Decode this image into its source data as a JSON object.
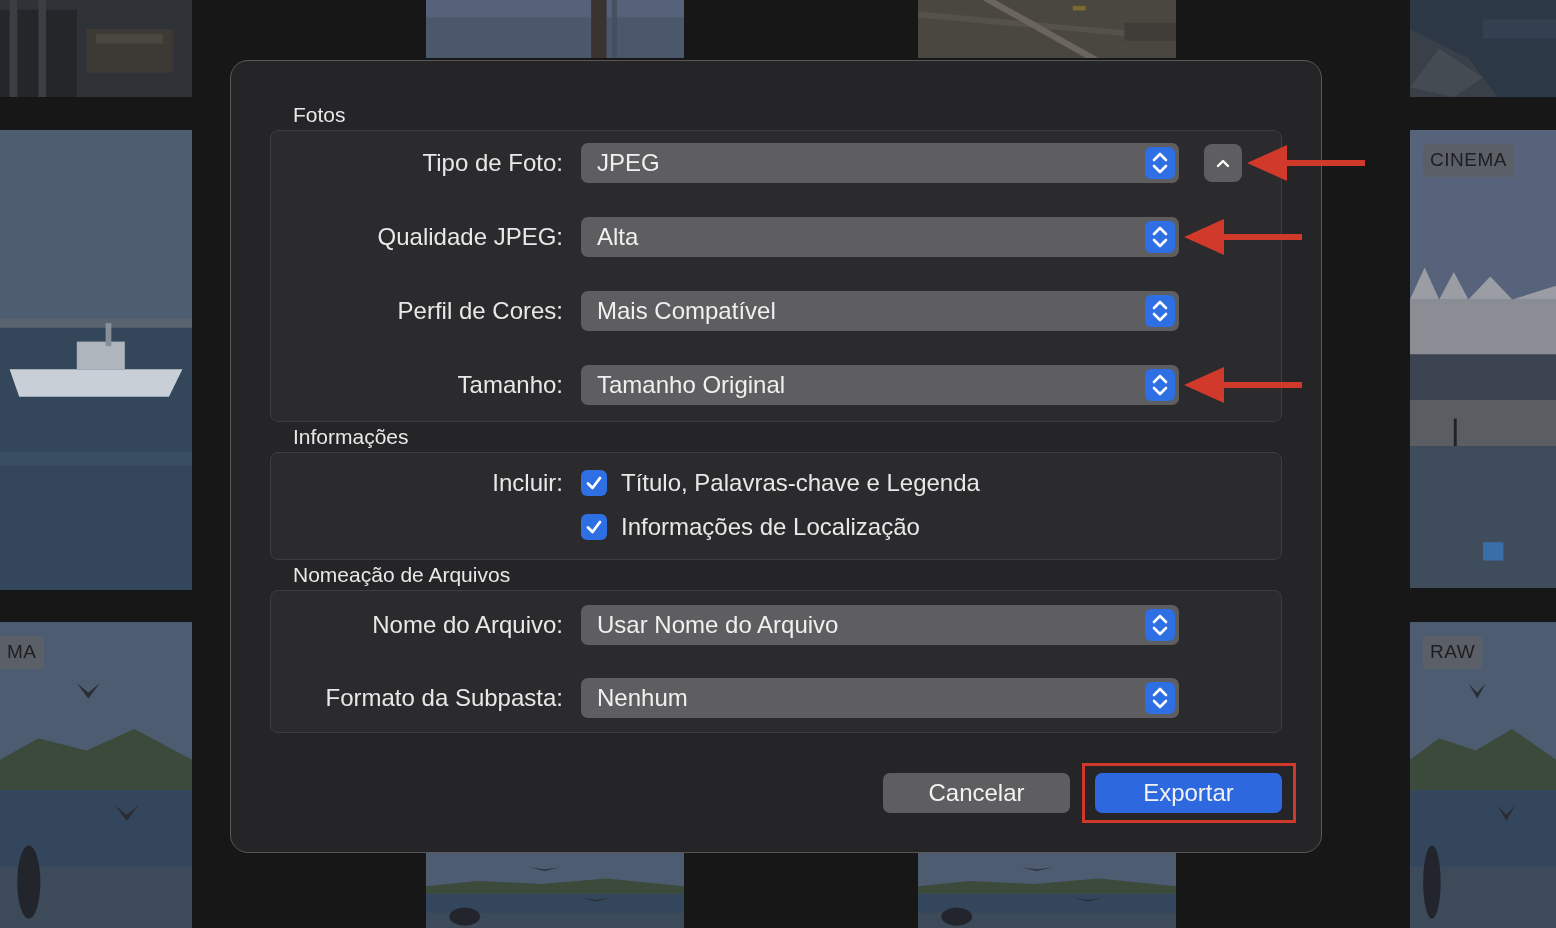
{
  "photo_grid": {
    "badges": [
      "MA",
      "CINEMA",
      "RAW"
    ]
  },
  "dialog": {
    "sections": [
      {
        "title": "Fotos",
        "rows": [
          {
            "kind": "select",
            "label": "Tipo de Foto:",
            "value": "JPEG",
            "collapse_button": true,
            "arrow": true
          },
          {
            "kind": "select",
            "label": "Qualidade JPEG:",
            "value": "Alta",
            "arrow": true
          },
          {
            "kind": "select",
            "label": "Perfil de Cores:",
            "value": "Mais Compatível"
          },
          {
            "kind": "select",
            "label": "Tamanho:",
            "value": "Tamanho Original",
            "arrow": true
          }
        ]
      },
      {
        "title": "Informações",
        "rows": [
          {
            "kind": "checkbox",
            "label": "Incluir:",
            "text": "Título, Palavras-chave e Legenda",
            "checked": true
          },
          {
            "kind": "checkbox",
            "text": "Informações de Localização",
            "checked": true
          }
        ]
      },
      {
        "title": "Nomeação de Arquivos",
        "rows": [
          {
            "kind": "select",
            "label": "Nome do Arquivo:",
            "value": "Usar Nome do Arquivo"
          },
          {
            "kind": "select",
            "label": "Formato da Subpasta:",
            "value": "Nenhum"
          }
        ]
      }
    ],
    "buttons": [
      {
        "kind": "secondary",
        "label": "Cancelar",
        "highlighted": false
      },
      {
        "kind": "primary",
        "label": "Exportar",
        "highlighted": true
      }
    ]
  }
}
